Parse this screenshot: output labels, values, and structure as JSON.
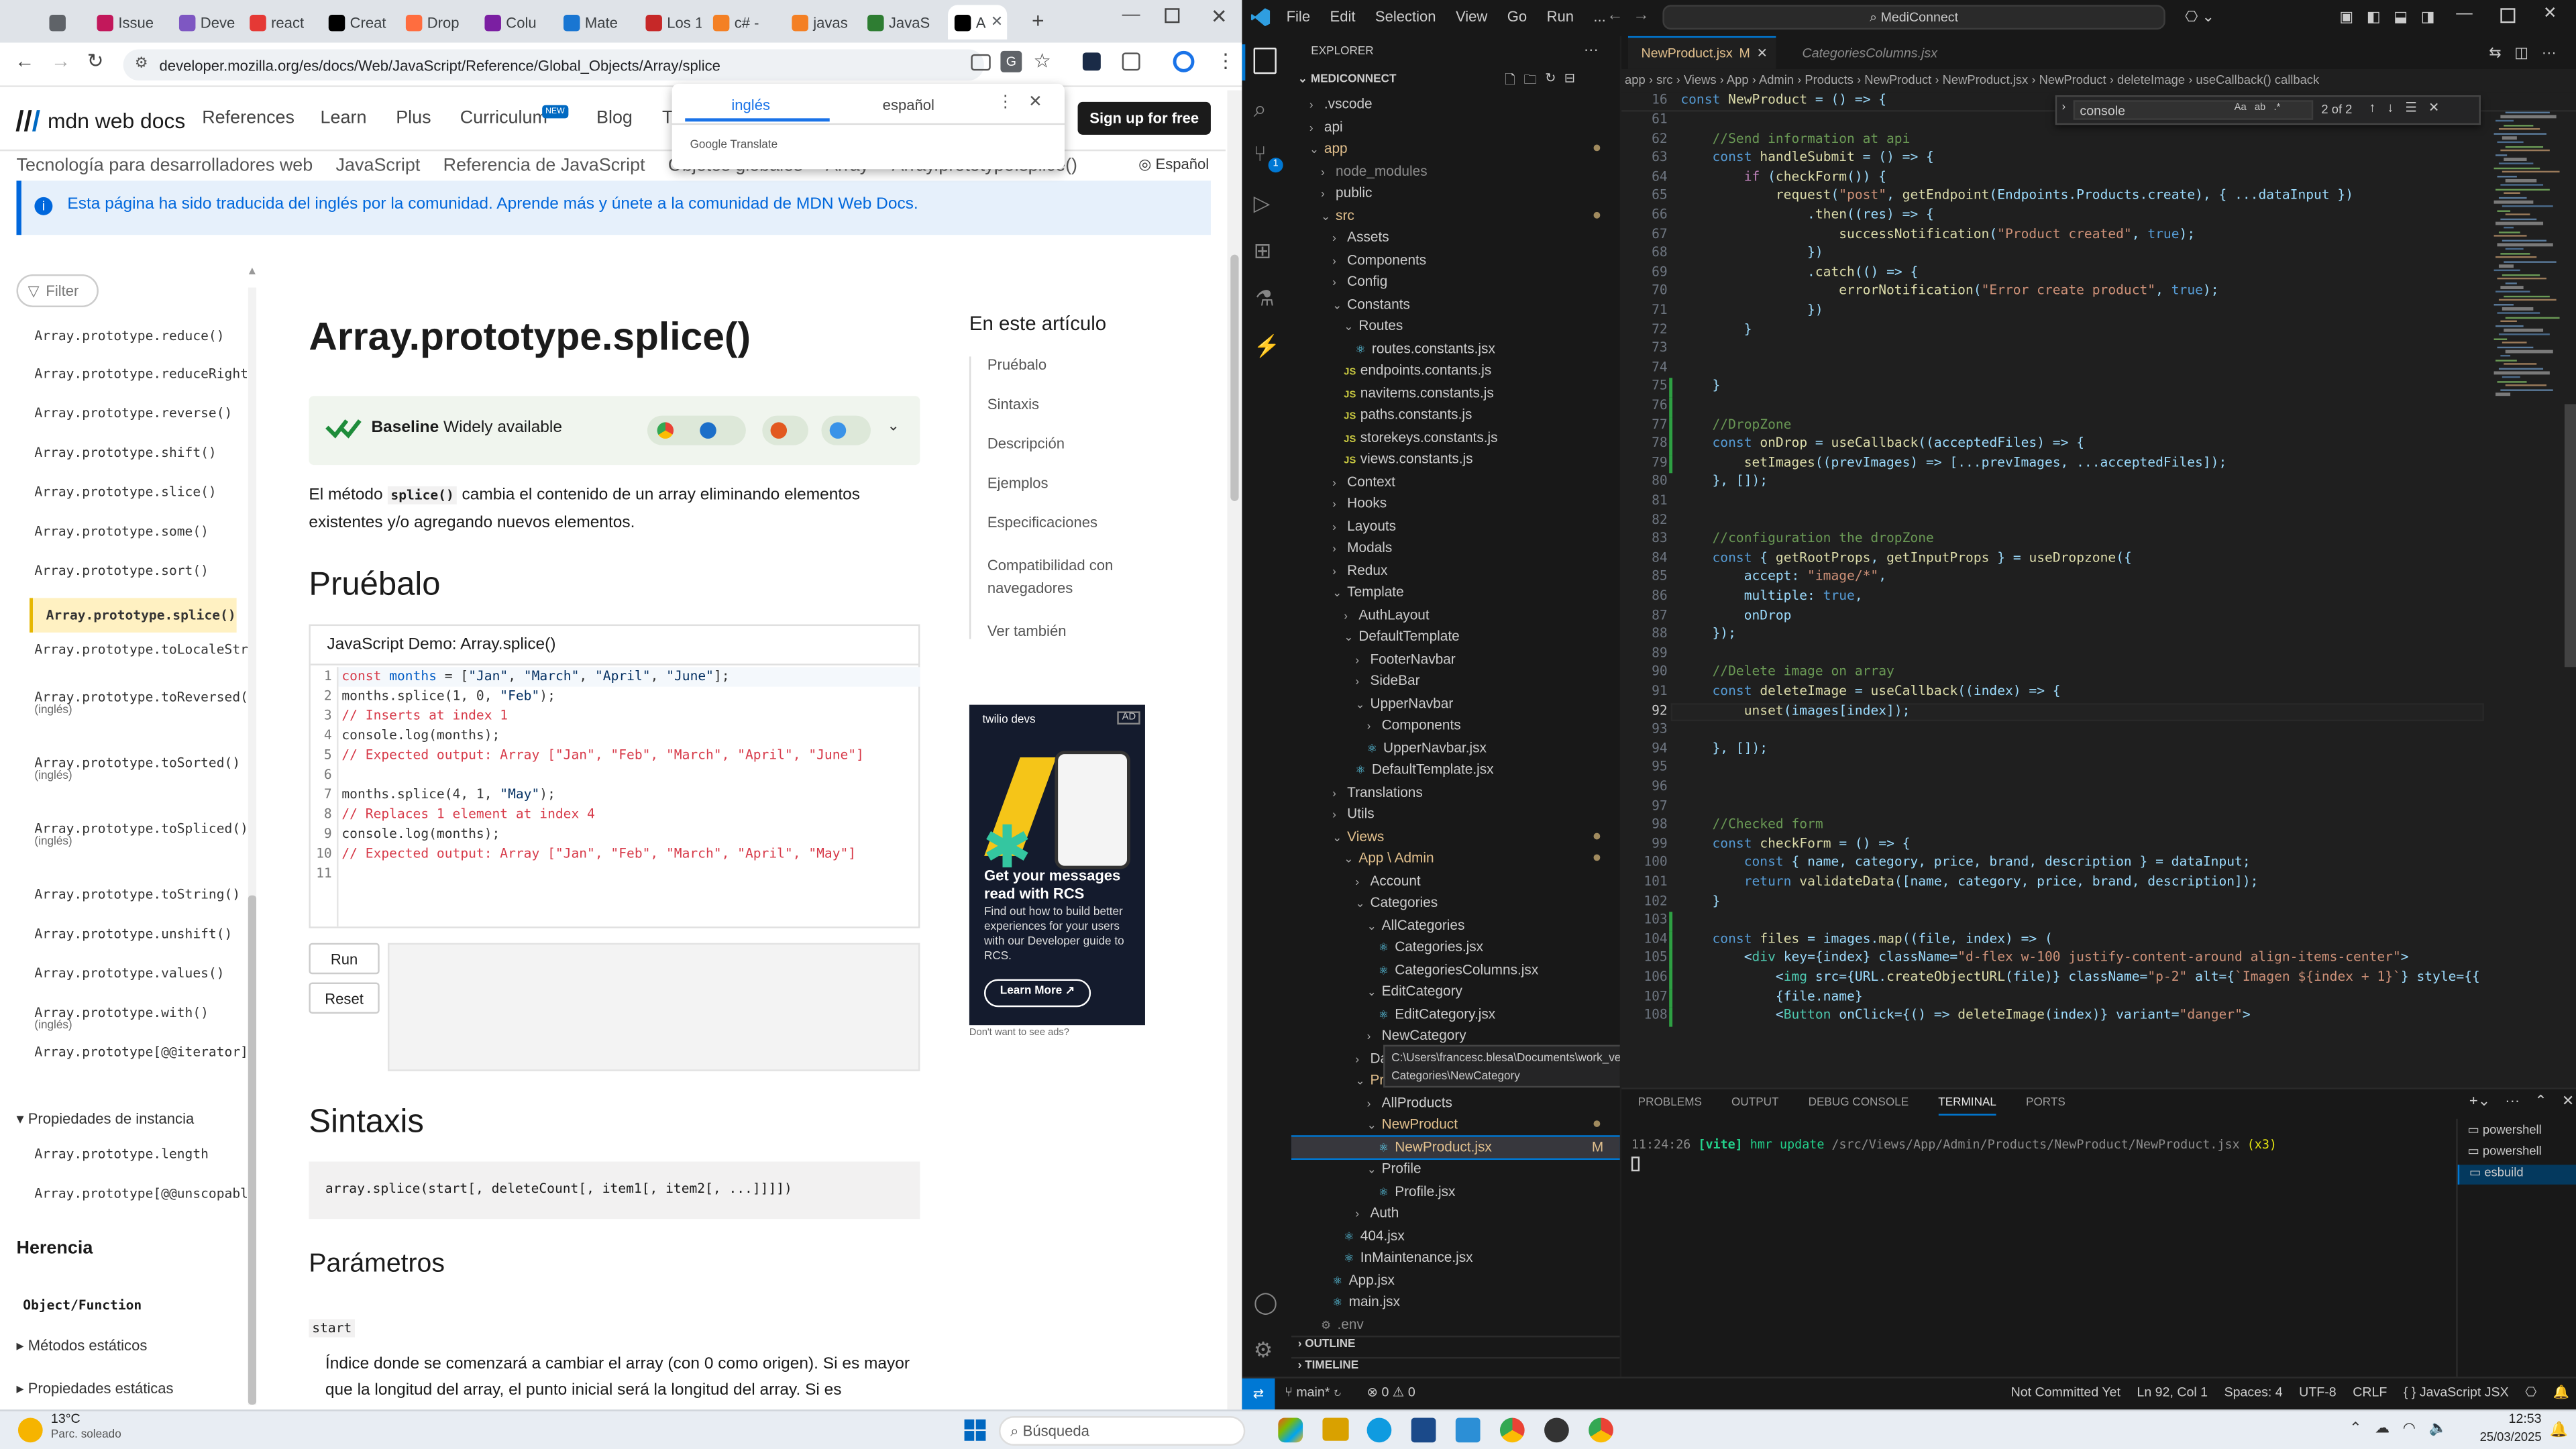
{
  "browser": {
    "tabs": [
      {
        "label": "",
        "color": "#5f6368"
      },
      {
        "label": "Issue",
        "color": "#c2185b"
      },
      {
        "label": "Devel",
        "color": "#7e57c2"
      },
      {
        "label": "react",
        "color": "#e53935"
      },
      {
        "label": "Creat",
        "color": "#000000"
      },
      {
        "label": "Drop",
        "color": "#ff6d3f"
      },
      {
        "label": "Colu",
        "color": "#7b1fa2"
      },
      {
        "label": "Mate",
        "color": "#1976d2"
      },
      {
        "label": "Los 1",
        "color": "#c62828"
      },
      {
        "label": "c# - ",
        "color": "#f48024"
      },
      {
        "label": "javas",
        "color": "#f48024"
      },
      {
        "label": "JavaS",
        "color": "#2e7d32"
      },
      {
        "label": "A",
        "color": "#000000"
      }
    ],
    "url": "developer.mozilla.org/es/docs/Web/JavaScript/Reference/Global_Objects/Array/splice"
  },
  "mdn": {
    "logo": "mdn web docs",
    "nav": [
      "References",
      "Learn",
      "Plus",
      "Curriculum",
      "Blog",
      "T"
    ],
    "nav_badge": "NEW",
    "signup": "Sign up for free",
    "breadcrumbs": [
      "Tecnología para desarrolladores web",
      "JavaScript",
      "Referencia de JavaScript",
      "Objetos globales",
      "Array",
      "Array.prototype.splice()"
    ],
    "language": "Español",
    "notice": "Esta página ha sido traducida del inglés por la comunidad. Aprende más y únete a la comunidad de MDN Web Docs.",
    "filter": "Filter",
    "sidebar": [
      {
        "label": "Array.prototype.reduce()",
        "sub": ""
      },
      {
        "label": "Array.prototype.reduceRight()",
        "sub": ""
      },
      {
        "label": "Array.prototype.reverse()",
        "sub": ""
      },
      {
        "label": "Array.prototype.shift()",
        "sub": ""
      },
      {
        "label": "Array.prototype.slice()",
        "sub": ""
      },
      {
        "label": "Array.prototype.some()",
        "sub": ""
      },
      {
        "label": "Array.prototype.sort()",
        "sub": ""
      },
      {
        "label": "Array.prototype.splice()",
        "sub": "",
        "selected": true
      },
      {
        "label": "Array.prototype.toLocaleString()",
        "sub": ""
      },
      {
        "label": "Array.prototype.toReversed()",
        "sub": "(inglés)"
      },
      {
        "label": "Array.prototype.toSorted()",
        "sub": "(inglés)"
      },
      {
        "label": "Array.prototype.toSpliced()",
        "sub": "(inglés)"
      },
      {
        "label": "Array.prototype.toString()",
        "sub": ""
      },
      {
        "label": "Array.prototype.unshift()",
        "sub": ""
      },
      {
        "label": "Array.prototype.values()",
        "sub": ""
      },
      {
        "label": "Array.prototype.with()",
        "sub": "(inglés)"
      },
      {
        "label": "Array.prototype[@@iterator]()",
        "sub": ""
      }
    ],
    "sidebar_section": "Propiedades de instancia",
    "sidebar_props": [
      "Array.prototype.length",
      "Array.prototype[@@unscopables]"
    ],
    "herencia": "Herencia",
    "object_function": "Object/Function",
    "metodos_estaticos": "Métodos estáticos",
    "propiedades_estaticas": "Propiedades estáticas",
    "title": "Array.prototype.splice()",
    "baseline": "Baseline",
    "baseline_desc": "Widely available",
    "intro_pre": "El método ",
    "intro_code": "splice()",
    "intro_post": " cambia el contenido de un array eliminando elementos existentes y/o agregando nuevos elementos.",
    "h_pruebalo": "Pruébalo",
    "demo_title": "JavaScript Demo: Array.splice()",
    "demo_lines": [
      "const months = [\"Jan\", \"March\", \"April\", \"June\"];",
      "months.splice(1, 0, \"Feb\");",
      "// Inserts at index 1",
      "console.log(months);",
      "// Expected output: Array [\"Jan\", \"Feb\", \"March\", \"April\", \"June\"]",
      "",
      "months.splice(4, 1, \"May\");",
      "// Replaces 1 element at index 4",
      "console.log(months);",
      "// Expected output: Array [\"Jan\", \"Feb\", \"March\", \"April\", \"May\"]",
      ""
    ],
    "run": "Run",
    "reset": "Reset",
    "h_sintaxis": "Sintaxis",
    "syntax": "array.splice(start[, deleteCount[, item1[, item2[, ...]]]])",
    "h_parametros": "Parámetros",
    "param_start": "start",
    "param_desc": "Índice donde se comenzará a cambiar el array (con 0 como origen). Si es mayor que la longitud del array, el punto inicial será la longitud del array. Si es",
    "toc_title": "En este artículo",
    "toc": [
      "Pruébalo",
      "Sintaxis",
      "Descripción",
      "Ejemplos",
      "Especificaciones",
      "Compatibilidad con navegadores",
      "Ver también"
    ],
    "ad": {
      "brand": "twilio devs",
      "badge": "AD",
      "headline": "Get your messages read with RCS",
      "body": "Find out how to build better experiences for your users with our Developer guide to RCS.",
      "cta": "Learn More",
      "footer": "Don't want to see ads?"
    }
  },
  "translate": {
    "tab_en": "inglés",
    "tab_es": "español",
    "footer": "Google Translate"
  },
  "vscode": {
    "menu": [
      "File",
      "Edit",
      "Selection",
      "View",
      "Go",
      "Run",
      "..."
    ],
    "search": "MediConnect",
    "explorer_title": "EXPLORER",
    "project": "MEDICONNECT",
    "tree": [
      {
        "l": ".vscode",
        "d": 1,
        "t": "f"
      },
      {
        "l": "api",
        "d": 1,
        "t": "f"
      },
      {
        "l": "app",
        "d": 1,
        "t": "o",
        "c": "#e2c08d"
      },
      {
        "l": "node_modules",
        "d": 2,
        "t": "f",
        "c": "#8c8c8c"
      },
      {
        "l": "public",
        "d": 2,
        "t": "f"
      },
      {
        "l": "src",
        "d": 2,
        "t": "o",
        "c": "#e2c08d"
      },
      {
        "l": "Assets",
        "d": 3,
        "t": "f"
      },
      {
        "l": "Components",
        "d": 3,
        "t": "f"
      },
      {
        "l": "Config",
        "d": 3,
        "t": "f"
      },
      {
        "l": "Constants",
        "d": 3,
        "t": "o"
      },
      {
        "l": "Routes",
        "d": 4,
        "t": "o"
      },
      {
        "l": "routes.constants.jsx",
        "d": 5,
        "t": "r"
      },
      {
        "l": "endpoints.contants.js",
        "d": 4,
        "t": "j"
      },
      {
        "l": "navitems.constants.js",
        "d": 4,
        "t": "j"
      },
      {
        "l": "paths.constants.js",
        "d": 4,
        "t": "j"
      },
      {
        "l": "storekeys.constants.js",
        "d": 4,
        "t": "j"
      },
      {
        "l": "views.constants.js",
        "d": 4,
        "t": "j"
      },
      {
        "l": "Context",
        "d": 3,
        "t": "f"
      },
      {
        "l": "Hooks",
        "d": 3,
        "t": "f"
      },
      {
        "l": "Layouts",
        "d": 3,
        "t": "f"
      },
      {
        "l": "Modals",
        "d": 3,
        "t": "f"
      },
      {
        "l": "Redux",
        "d": 3,
        "t": "f"
      },
      {
        "l": "Template",
        "d": 3,
        "t": "o"
      },
      {
        "l": "AuthLayout",
        "d": 4,
        "t": "f"
      },
      {
        "l": "DefaultTemplate",
        "d": 4,
        "t": "o"
      },
      {
        "l": "FooterNavbar",
        "d": 5,
        "t": "f"
      },
      {
        "l": "SideBar",
        "d": 5,
        "t": "f"
      },
      {
        "l": "UpperNavbar",
        "d": 5,
        "t": "o"
      },
      {
        "l": "Components",
        "d": 6,
        "t": "f"
      },
      {
        "l": "UpperNavbar.jsx",
        "d": 6,
        "t": "r"
      },
      {
        "l": "DefaultTemplate.jsx",
        "d": 5,
        "t": "r"
      },
      {
        "l": "Translations",
        "d": 3,
        "t": "f"
      },
      {
        "l": "Utils",
        "d": 3,
        "t": "f"
      },
      {
        "l": "Views",
        "d": 3,
        "t": "o",
        "c": "#e2c08d"
      },
      {
        "l": "App \\ Admin",
        "d": 4,
        "t": "o",
        "c": "#e2c08d"
      },
      {
        "l": "Account",
        "d": 5,
        "t": "f"
      },
      {
        "l": "Categories",
        "d": 5,
        "t": "o"
      },
      {
        "l": "AllCategories",
        "d": 6,
        "t": "o"
      },
      {
        "l": "Categories.jsx",
        "d": 7,
        "t": "r"
      },
      {
        "l": "CategoriesColumns.jsx",
        "d": 7,
        "t": "r"
      },
      {
        "l": "EditCategory",
        "d": 6,
        "t": "o"
      },
      {
        "l": "EditCategory.jsx",
        "d": 7,
        "t": "r"
      },
      {
        "l": "NewCategory",
        "d": 6,
        "t": "f"
      },
      {
        "l": "Dashboard",
        "d": 5,
        "t": "f"
      },
      {
        "l": "Products",
        "d": 5,
        "t": "o",
        "c": "#e2c08d"
      },
      {
        "l": "AllProducts",
        "d": 6,
        "t": "f"
      },
      {
        "l": "NewProduct",
        "d": 6,
        "t": "o",
        "c": "#e2c08d"
      },
      {
        "l": "NewProduct.jsx",
        "d": 7,
        "t": "r",
        "c": "#e2c08d",
        "sel": true,
        "m": "M"
      },
      {
        "l": "Profile",
        "d": 6,
        "t": "o"
      },
      {
        "l": "Profile.jsx",
        "d": 7,
        "t": "r"
      },
      {
        "l": "Auth",
        "d": 5,
        "t": "f"
      },
      {
        "l": "404.jsx",
        "d": 4,
        "t": "r"
      },
      {
        "l": "InMaintenance.jsx",
        "d": 4,
        "t": "r"
      },
      {
        "l": "App.jsx",
        "d": 3,
        "t": "r"
      },
      {
        "l": "main.jsx",
        "d": 3,
        "t": "r"
      },
      {
        "l": ".env",
        "d": 2,
        "t": "g",
        "c": "#8c8c8c"
      }
    ],
    "tooltip_path": "C:\\Users\\francesc.blesa\\Documents\\work_versioned\\MediConnect\\app\\src\\Views\\App\\Admin\\",
    "tooltip_path2": "Categories\\NewCategory",
    "outline": "OUTLINE",
    "timeline": "TIMELINE",
    "tab_active": "NewProduct.jsx",
    "tab_active_mark": "M",
    "tab_other": "CategoriesColumns.jsx",
    "breadcrumbs": [
      "app",
      "src",
      "Views",
      "App",
      "Admin",
      "Products",
      "NewProduct",
      "NewProduct.jsx",
      "NewProduct",
      "deleteImage",
      "useCallback() callback"
    ],
    "sticky_line_no": "16",
    "sticky_line": "const NewProduct = () => {",
    "find": {
      "value": "console",
      "count": "2 of 2"
    },
    "code_start": 61,
    "code": [
      "",
      "    //Send information at api",
      "    const handleSubmit = () => {",
      "        if (checkForm()) {",
      "            request(\"post\", getEndpoint(Endpoints.Products.create), { ...dataInput })",
      "                .then((res) => {",
      "                    successNotification(\"Product created\", true);",
      "                })",
      "                .catch(() => {",
      "                    errorNotification(\"Error create product\", true);",
      "                })",
      "        }",
      "",
      "",
      "    }",
      "",
      "    //DropZone",
      "    const onDrop = useCallback((acceptedFiles) => {",
      "        setImages((prevImages) => [...prevImages, ...acceptedFiles]);",
      "    }, []);",
      "",
      "",
      "    //configuration the dropZone",
      "    const { getRootProps, getInputProps } = useDropzone({",
      "        accept: \"image/*\",",
      "        multiple: true,",
      "        onDrop",
      "    });",
      "",
      "    //Delete image on array",
      "    const deleteImage = useCallback((index) => {",
      "        unset(images[index]);",
      "",
      "    }, []);",
      "",
      "",
      "",
      "    //Checked form",
      "    const checkForm = () => {",
      "        const { name, category, price, brand, description } = dataInput;",
      "        return validateData([name, category, price, brand, description]);",
      "    }",
      "",
      "    const files = images.map((file, index) => (",
      "        <div key={index} className=\"d-flex w-100 justify-content-around align-items-center\">",
      "            <img src={URL.createObjectURL(file)} className=\"p-2\" alt={`Imagen ${index + 1}`} style={{ wi",
      "            {file.name}",
      "            <Button onClick={() => deleteImage(index)} variant=\"danger\">"
    ],
    "panel_tabs": [
      "PROBLEMS",
      "OUTPUT",
      "DEBUG CONSOLE",
      "TERMINAL",
      "PORTS"
    ],
    "terminal_time": "11:24:26",
    "terminal_vite": "[vite]",
    "terminal_msg": "hmr update",
    "terminal_path": "/src/Views/App/Admin/Products/NewProduct/NewProduct.jsx",
    "terminal_x": "(x3)",
    "terminals": [
      "powershell",
      "powershell",
      "esbuild"
    ],
    "status": {
      "branch": "main*",
      "errors": "0",
      "warnings": "0",
      "commit": "Not Committed Yet",
      "pos": "Ln 92, Col 1",
      "spaces": "Spaces: 4",
      "enc": "UTF-8",
      "eol": "CRLF",
      "lang": "JavaScript JSX"
    }
  },
  "taskbar": {
    "weather_temp": "13°C",
    "weather_desc": "Parc. soleado",
    "search": "Búsqueda",
    "time": "12:53",
    "date": "25/03/2025"
  }
}
